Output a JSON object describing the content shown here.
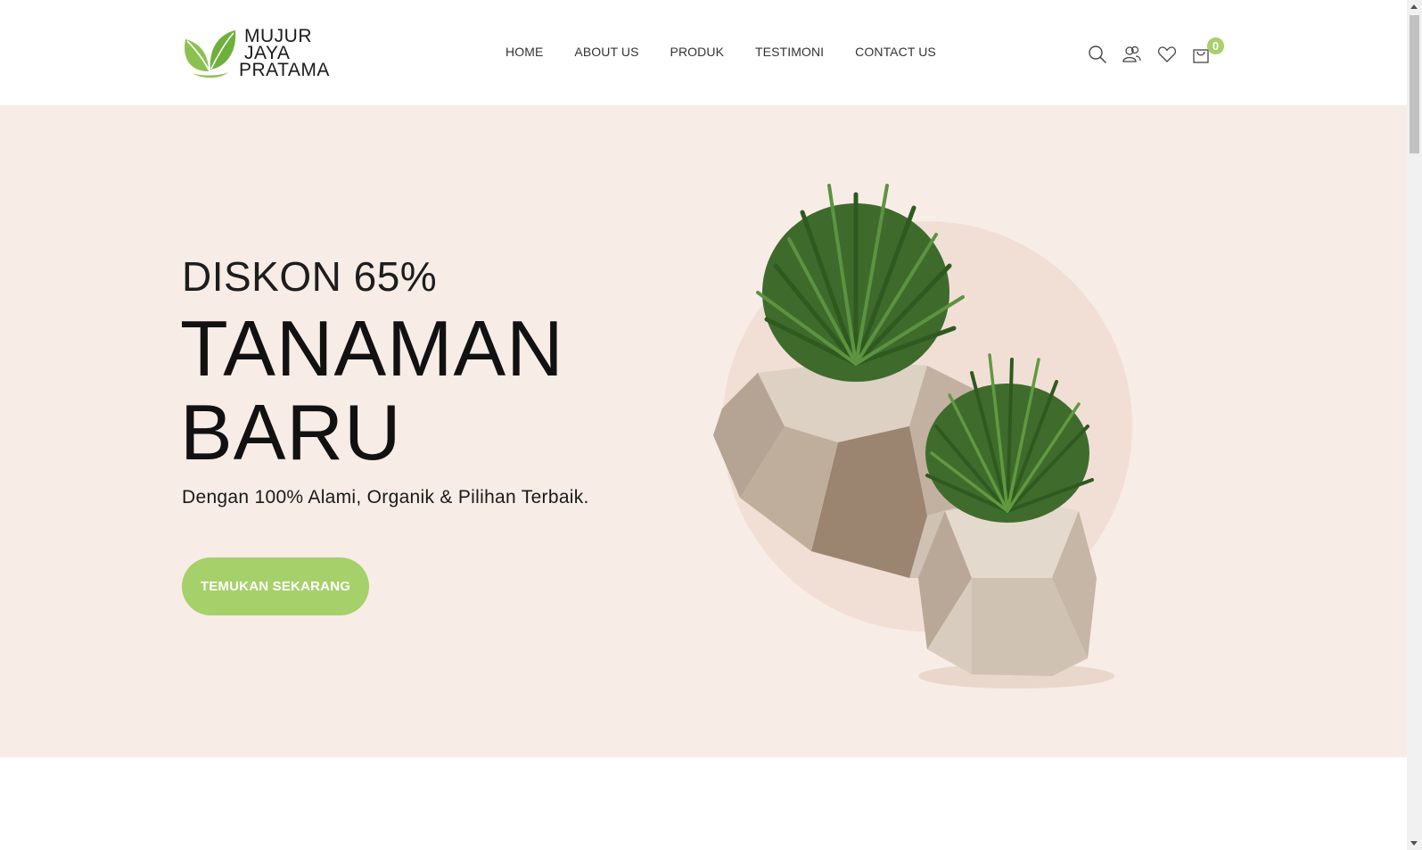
{
  "brand": {
    "name_line1": "MUJUR",
    "name_line2": "JAYA",
    "name_line3": "PRATAMA",
    "logo_icon": "leaf-sprout-icon",
    "accent_color": "#a6d06a"
  },
  "nav": {
    "items": [
      {
        "label": "HOME"
      },
      {
        "label": "ABOUT US"
      },
      {
        "label": "PRODUK"
      },
      {
        "label": "TESTIMONI"
      },
      {
        "label": "CONTACT US"
      }
    ]
  },
  "header_icons": {
    "search": "search-icon",
    "account": "users-icon",
    "wishlist": "heart-icon",
    "cart": "shopping-bag-icon",
    "cart_count": "0"
  },
  "hero": {
    "subtitle": "DISKON 65%",
    "title_line1": "TANAMAN",
    "title_line2": "BARU",
    "description": "Dengan 100% Alami, Organik & Pilihan Terbaik.",
    "cta_label": "TEMUKAN SEKARANG",
    "background_color": "#f7ece6",
    "image": "potted-plants-illustration"
  }
}
